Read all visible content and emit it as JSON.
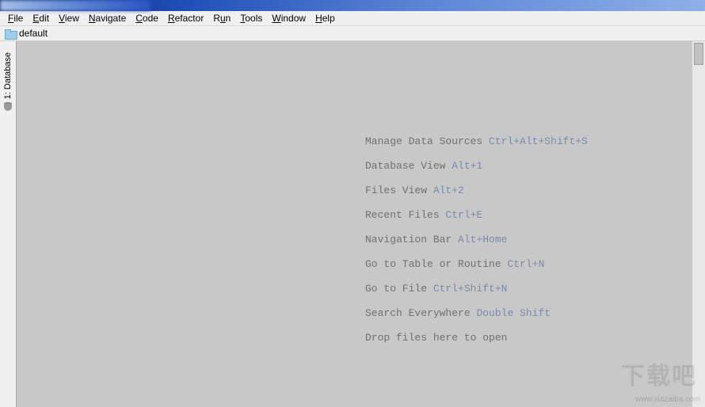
{
  "menu": [
    {
      "label": "File",
      "u": 0
    },
    {
      "label": "Edit",
      "u": 0
    },
    {
      "label": "View",
      "u": 0
    },
    {
      "label": "Navigate",
      "u": 0
    },
    {
      "label": "Code",
      "u": 0
    },
    {
      "label": "Refactor",
      "u": 0
    },
    {
      "label": "Run",
      "u": 1
    },
    {
      "label": "Tools",
      "u": 0
    },
    {
      "label": "Window",
      "u": 0
    },
    {
      "label": "Help",
      "u": 0
    }
  ],
  "nav": {
    "project_label": "default"
  },
  "side_tool": {
    "label": "1: Database"
  },
  "hints": [
    {
      "text": "Manage Data Sources",
      "shortcut": "Ctrl+Alt+Shift+S"
    },
    {
      "text": "Database View",
      "shortcut": "Alt+1"
    },
    {
      "text": "Files View",
      "shortcut": "Alt+2"
    },
    {
      "text": "Recent Files",
      "shortcut": "Ctrl+E"
    },
    {
      "text": "Navigation Bar",
      "shortcut": "Alt+Home"
    },
    {
      "text": "Go to Table or Routine",
      "shortcut": "Ctrl+N"
    },
    {
      "text": "Go to File",
      "shortcut": "Ctrl+Shift+N"
    },
    {
      "text": "Search Everywhere",
      "shortcut": "Double Shift"
    },
    {
      "text": "Drop files here to open",
      "shortcut": ""
    }
  ],
  "watermark": {
    "cn": "下载吧",
    "url": "www.xiazaiba.com"
  }
}
